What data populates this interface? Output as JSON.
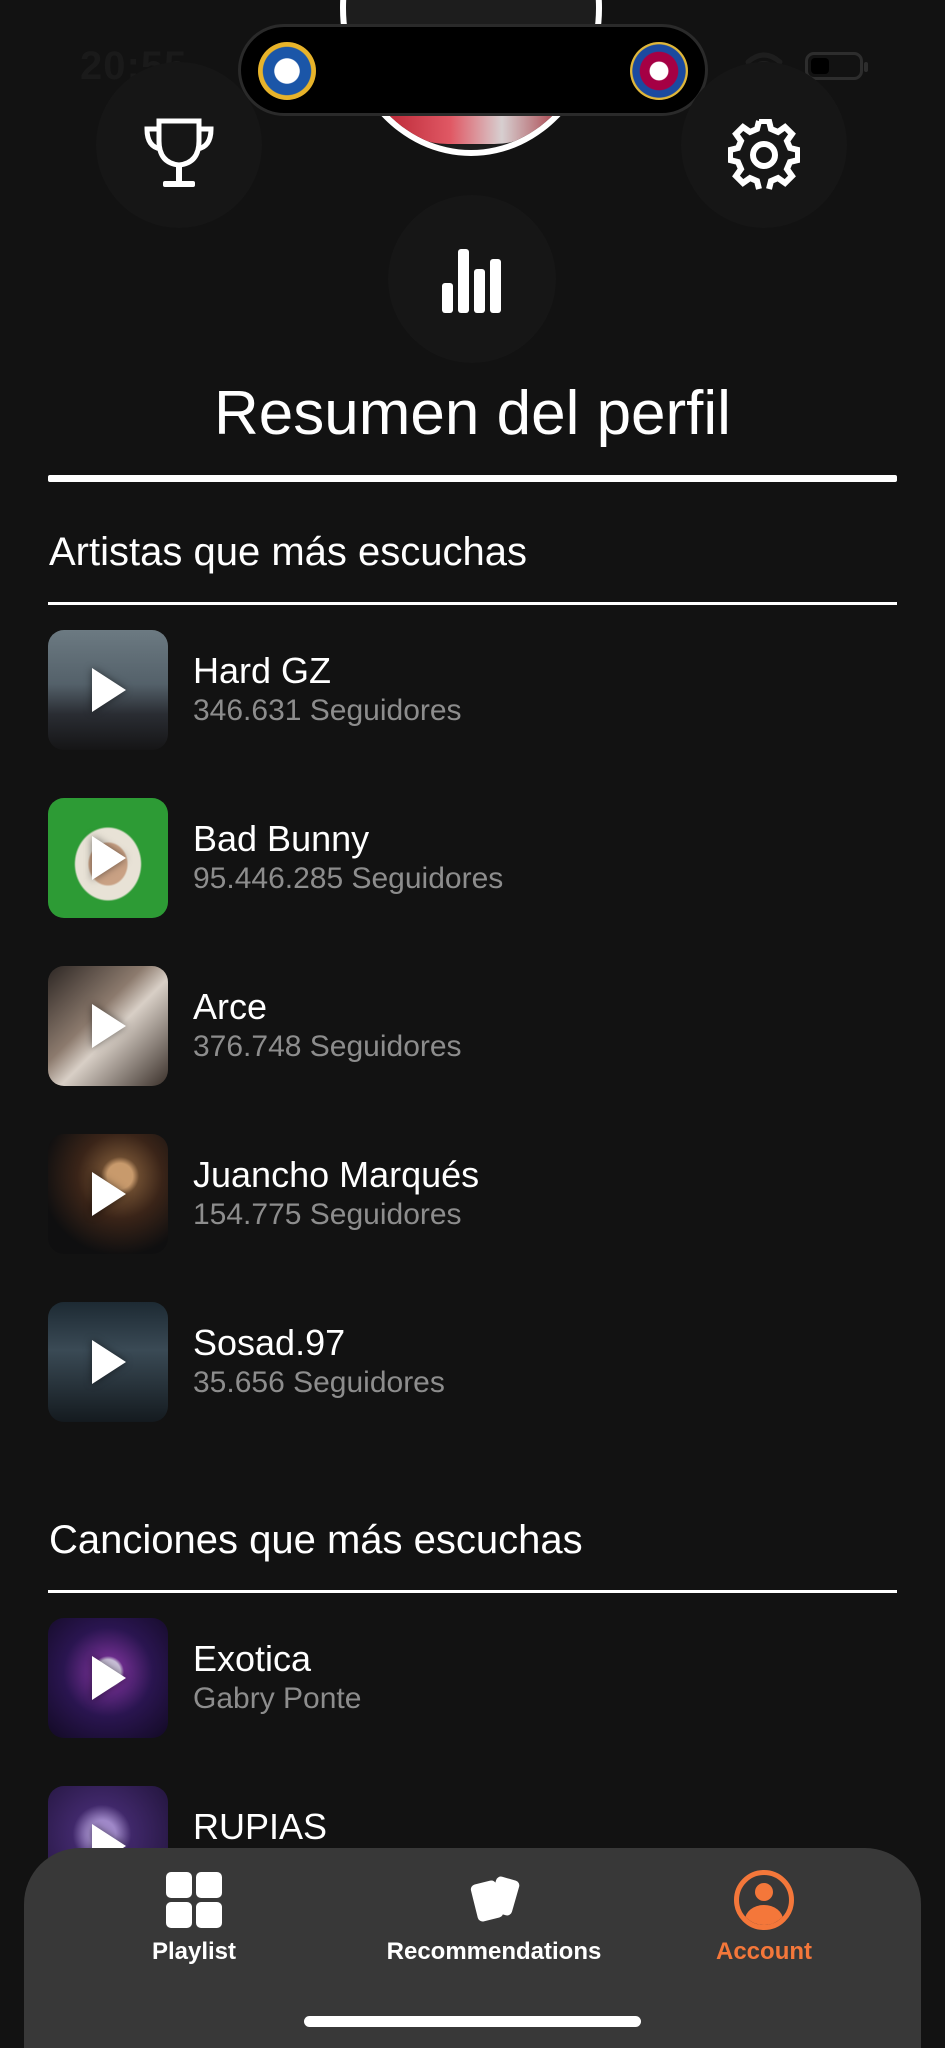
{
  "status_bar": {
    "time": "20:55"
  },
  "header": {
    "title": "Resumen del perfil"
  },
  "artists_section": {
    "title": "Artistas que más escuchas",
    "items": [
      {
        "name": "Hard GZ",
        "followers": "346.631 Seguidores"
      },
      {
        "name": "Bad Bunny",
        "followers": "95.446.285 Seguidores"
      },
      {
        "name": "Arce",
        "followers": "376.748 Seguidores"
      },
      {
        "name": "Juancho Marqués",
        "followers": "154.775 Seguidores"
      },
      {
        "name": "Sosad.97",
        "followers": "35.656 Seguidores"
      }
    ]
  },
  "songs_section": {
    "title": "Canciones que más escuchas",
    "items": [
      {
        "name": "Exotica",
        "artist": "Gabry Ponte"
      },
      {
        "name": "RUPIAS",
        "artist": ""
      }
    ]
  },
  "tab_bar": {
    "tabs": [
      {
        "label": "Playlist",
        "icon": "grid-icon",
        "active": false
      },
      {
        "label": "Recommendations",
        "icon": "cards-icon",
        "active": false
      },
      {
        "label": "Account",
        "icon": "account-icon",
        "active": true
      }
    ],
    "active_color": "#f4773a"
  },
  "icons": [
    "trophy-icon",
    "settings-icon",
    "stats-icon",
    "play-icon"
  ]
}
